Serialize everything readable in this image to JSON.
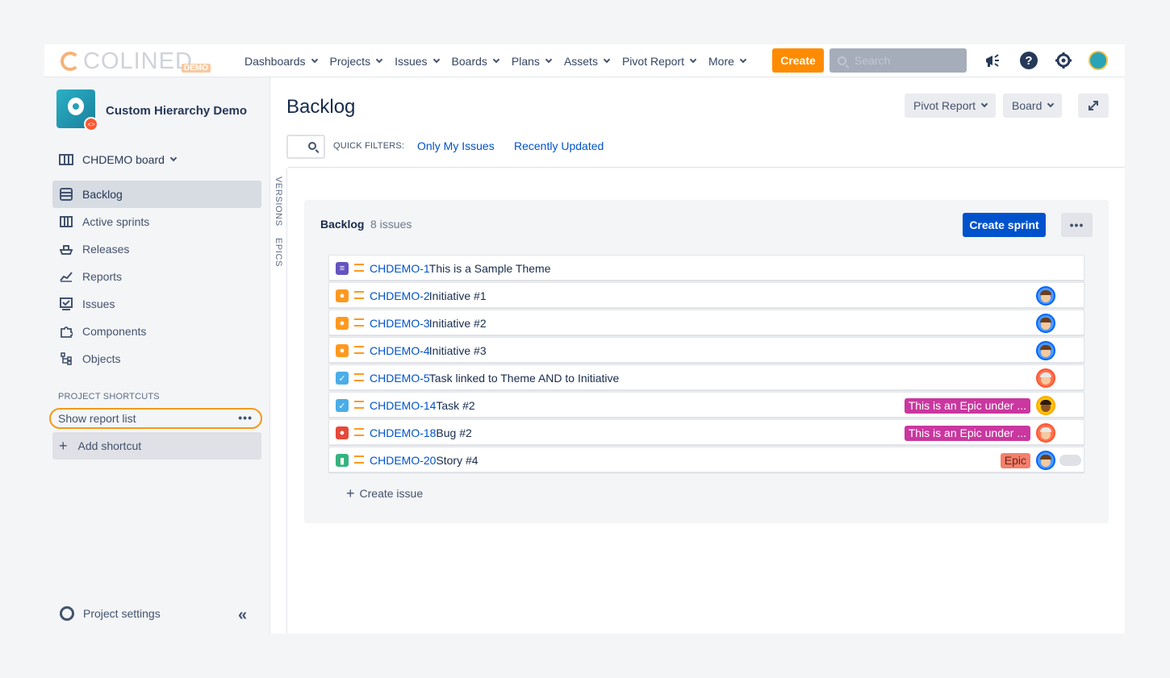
{
  "brand": {
    "logo_text": "COLINED",
    "logo_badge": "DEMO",
    "accent": "#ff8b00"
  },
  "topnav": {
    "items": [
      "Dashboards",
      "Projects",
      "Issues",
      "Boards",
      "Plans",
      "Assets",
      "Pivot Report",
      "More"
    ],
    "create_label": "Create",
    "search_placeholder": "Search"
  },
  "sidebar": {
    "project_name": "Custom Hierarchy Demo",
    "board_selector": "CHDEMO board",
    "items": [
      {
        "label": "Backlog",
        "icon": "backlog-icon",
        "active": true
      },
      {
        "label": "Active sprints",
        "icon": "board-icon",
        "active": false
      },
      {
        "label": "Releases",
        "icon": "ship-icon",
        "active": false
      },
      {
        "label": "Reports",
        "icon": "chart-icon",
        "active": false
      },
      {
        "label": "Issues",
        "icon": "issues-icon",
        "active": false
      },
      {
        "label": "Components",
        "icon": "puzzle-icon",
        "active": false
      },
      {
        "label": "Objects",
        "icon": "tree-icon",
        "active": false
      }
    ],
    "shortcuts_heading": "PROJECT SHORTCUTS",
    "shortcut_label": "Show report list",
    "add_shortcut_label": "Add shortcut",
    "settings_label": "Project settings"
  },
  "side_tabs": {
    "versions": "VERSIONS",
    "epics": "EPICS"
  },
  "header": {
    "title": "Backlog",
    "pivot_report_btn": "Pivot Report",
    "board_btn": "Board",
    "quick_filters_label": "QUICK FILTERS:",
    "filters": [
      "Only My Issues",
      "Recently Updated"
    ]
  },
  "backlog": {
    "title": "Backlog",
    "count": "8 issues",
    "create_sprint_label": "Create sprint",
    "more_label": "•••",
    "create_issue_label": "Create issue",
    "issues": [
      {
        "key": "CHDEMO-1",
        "summary": "This is a Sample Theme",
        "type": "theme",
        "type_color": "#6554c0",
        "epic": null,
        "assignee": null
      },
      {
        "key": "CHDEMO-2",
        "summary": "Initiative #1",
        "type": "initiative",
        "type_color": "#ff991f",
        "epic": null,
        "assignee": "blue"
      },
      {
        "key": "CHDEMO-3",
        "summary": "Initiative #2",
        "type": "initiative",
        "type_color": "#ff991f",
        "epic": null,
        "assignee": "blue"
      },
      {
        "key": "CHDEMO-4",
        "summary": "Initiative #3",
        "type": "initiative",
        "type_color": "#ff991f",
        "epic": null,
        "assignee": "blue"
      },
      {
        "key": "CHDEMO-5",
        "summary": "Task linked to Theme AND to Initiative",
        "type": "task",
        "type_color": "#4bade8",
        "epic": null,
        "assignee": "red"
      },
      {
        "key": "CHDEMO-14",
        "summary": "Task #2",
        "type": "task",
        "type_color": "#4bade8",
        "epic": {
          "label": "This is an Epic under ...",
          "color": "#c9379f"
        },
        "assignee": "yellow"
      },
      {
        "key": "CHDEMO-18",
        "summary": "Bug #2",
        "type": "bug",
        "type_color": "#e5493a",
        "epic": {
          "label": "This is an Epic under ...",
          "color": "#c9379f"
        },
        "assignee": "red"
      },
      {
        "key": "CHDEMO-20",
        "summary": "Story #4",
        "type": "story",
        "type_color": "#36b37e",
        "epic": {
          "label": "Epic",
          "color": "#f57f6c",
          "text_color": "#5e2a1a"
        },
        "assignee": "blue",
        "toggle": true
      }
    ]
  }
}
